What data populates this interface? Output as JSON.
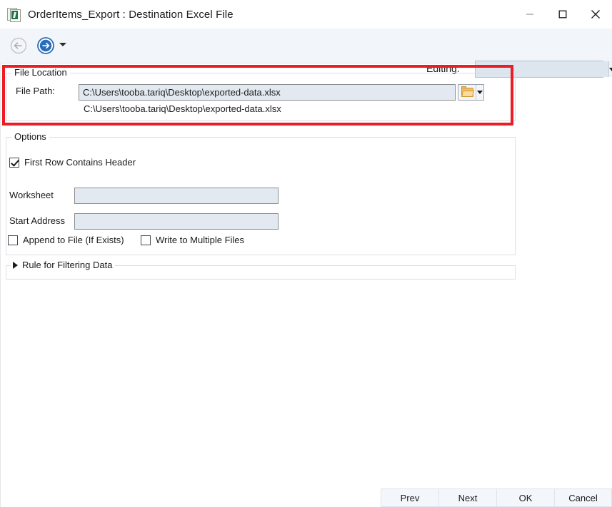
{
  "window": {
    "title": "OrderItems_Export : Destination Excel File",
    "icon": "excel-file-icon",
    "controls": {
      "minimize": "minimize-icon",
      "maximize": "maximize-icon",
      "close": "close-icon"
    }
  },
  "toolbar": {
    "back_icon": "back-arrow-icon",
    "forward_icon": "forward-arrow-icon",
    "dropdown_icon": "chevron-down-icon",
    "editing_label": "Editing:",
    "editing_value": "",
    "editing_placeholder": ""
  },
  "file_location": {
    "legend": "File Location",
    "file_path_label": "File Path:",
    "file_path_value": "C:\\Users\\tooba.tariq\\Desktop\\exported-data.xlsx",
    "file_path_placeholder": "",
    "browse_icon": "folder-icon",
    "browse_dropdown_icon": "chevron-down-icon",
    "file_path_echo": "C:\\Users\\tooba.tariq\\Desktop\\exported-data.xlsx",
    "highlight_color": "#ec1c24"
  },
  "options": {
    "legend": "Options",
    "first_row_contains_header": {
      "label": "First Row Contains Header",
      "checked": true
    },
    "worksheet": {
      "label": "Worksheet",
      "value": "",
      "placeholder": ""
    },
    "start_address": {
      "label": "Start Address",
      "value": "",
      "placeholder": ""
    },
    "append_to_file": {
      "label": "Append to File (If Exists)",
      "checked": false
    },
    "write_to_multiple_files": {
      "label": "Write to Multiple Files",
      "checked": false
    }
  },
  "filter": {
    "legend": "Rule for Filtering Data",
    "expander_icon": "triangle-right-icon",
    "expanded": false
  },
  "footer": {
    "buttons": [
      {
        "label": "Prev"
      },
      {
        "label": "Next"
      },
      {
        "label": "OK"
      },
      {
        "label": "Cancel"
      }
    ]
  }
}
